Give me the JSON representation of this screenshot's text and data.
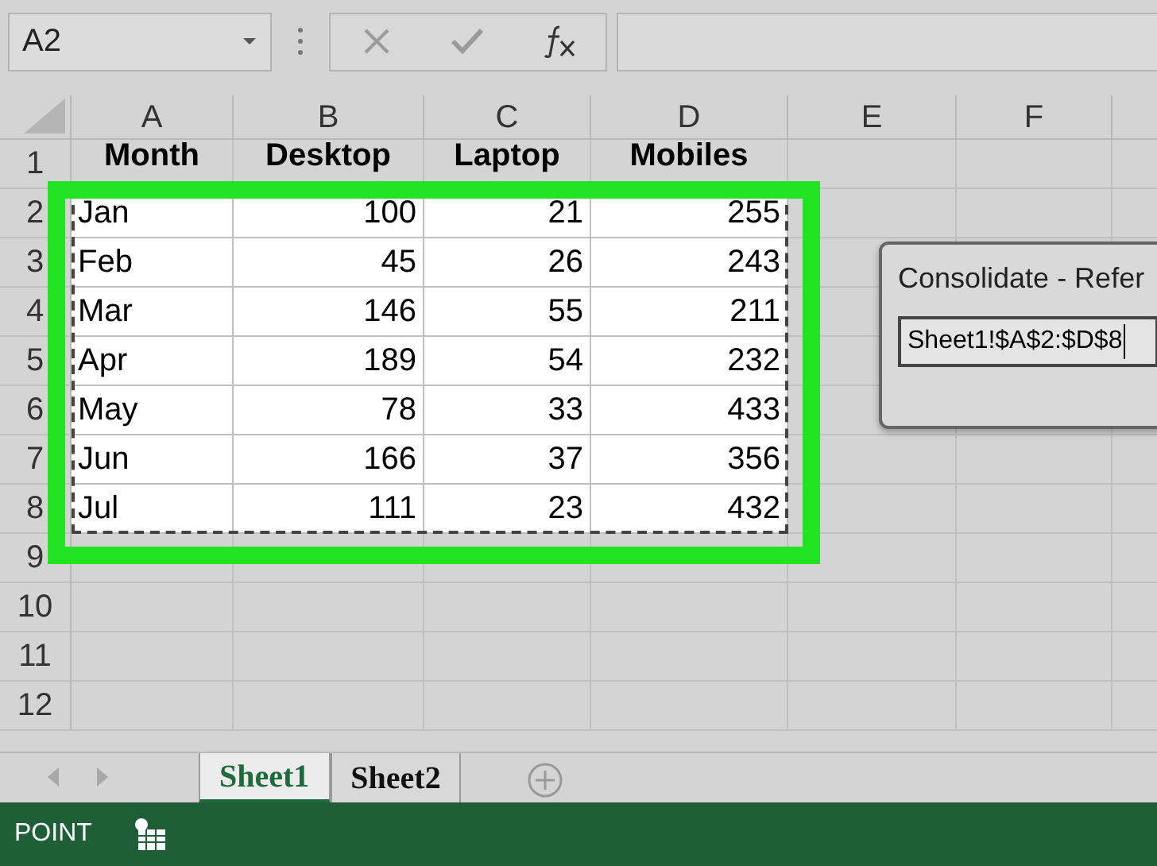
{
  "name_box": {
    "value": "A2"
  },
  "formula_buttons": [
    {
      "kind": "cancel",
      "disabled": true
    },
    {
      "kind": "enter",
      "disabled": true
    },
    {
      "kind": "function",
      "disabled": false
    }
  ],
  "columns": [
    "A",
    "B",
    "C",
    "D",
    "E",
    "F"
  ],
  "rows": [
    {
      "header": "1",
      "kind": "header",
      "selected": false,
      "cells": [
        "Month",
        "Desktop",
        "Laptop",
        "Mobiles"
      ]
    },
    {
      "header": "2",
      "kind": "data",
      "selected": true,
      "cells": [
        "Jan",
        "100",
        "21",
        "255"
      ]
    },
    {
      "header": "3",
      "kind": "data",
      "selected": true,
      "cells": [
        "Feb",
        "45",
        "26",
        "243"
      ]
    },
    {
      "header": "4",
      "kind": "data",
      "selected": true,
      "cells": [
        "Mar",
        "146",
        "55",
        "211"
      ]
    },
    {
      "header": "5",
      "kind": "data",
      "selected": true,
      "cells": [
        "Apr",
        "189",
        "54",
        "232"
      ]
    },
    {
      "header": "6",
      "kind": "data",
      "selected": true,
      "cells": [
        "May",
        "78",
        "33",
        "433"
      ]
    },
    {
      "header": "7",
      "kind": "data",
      "selected": true,
      "cells": [
        "Jun",
        "166",
        "37",
        "356"
      ]
    },
    {
      "header": "8",
      "kind": "data",
      "selected": true,
      "cells": [
        "Jul",
        "111",
        "23",
        "432"
      ]
    },
    {
      "header": "9",
      "kind": "data",
      "selected": false
    },
    {
      "header": "10",
      "kind": "data",
      "selected": false
    },
    {
      "header": "11",
      "kind": "data",
      "selected": false
    },
    {
      "header": "12",
      "kind": "data",
      "selected": false
    }
  ],
  "dialog": {
    "title": "Consolidate - Refer",
    "reference": "Sheet1!$A$2:$D$8"
  },
  "sheet_tabs": [
    {
      "label": "Sheet1",
      "selected": true
    },
    {
      "label": "Sheet2",
      "selected": false
    }
  ],
  "status_bar": {
    "mode": "POINT"
  }
}
